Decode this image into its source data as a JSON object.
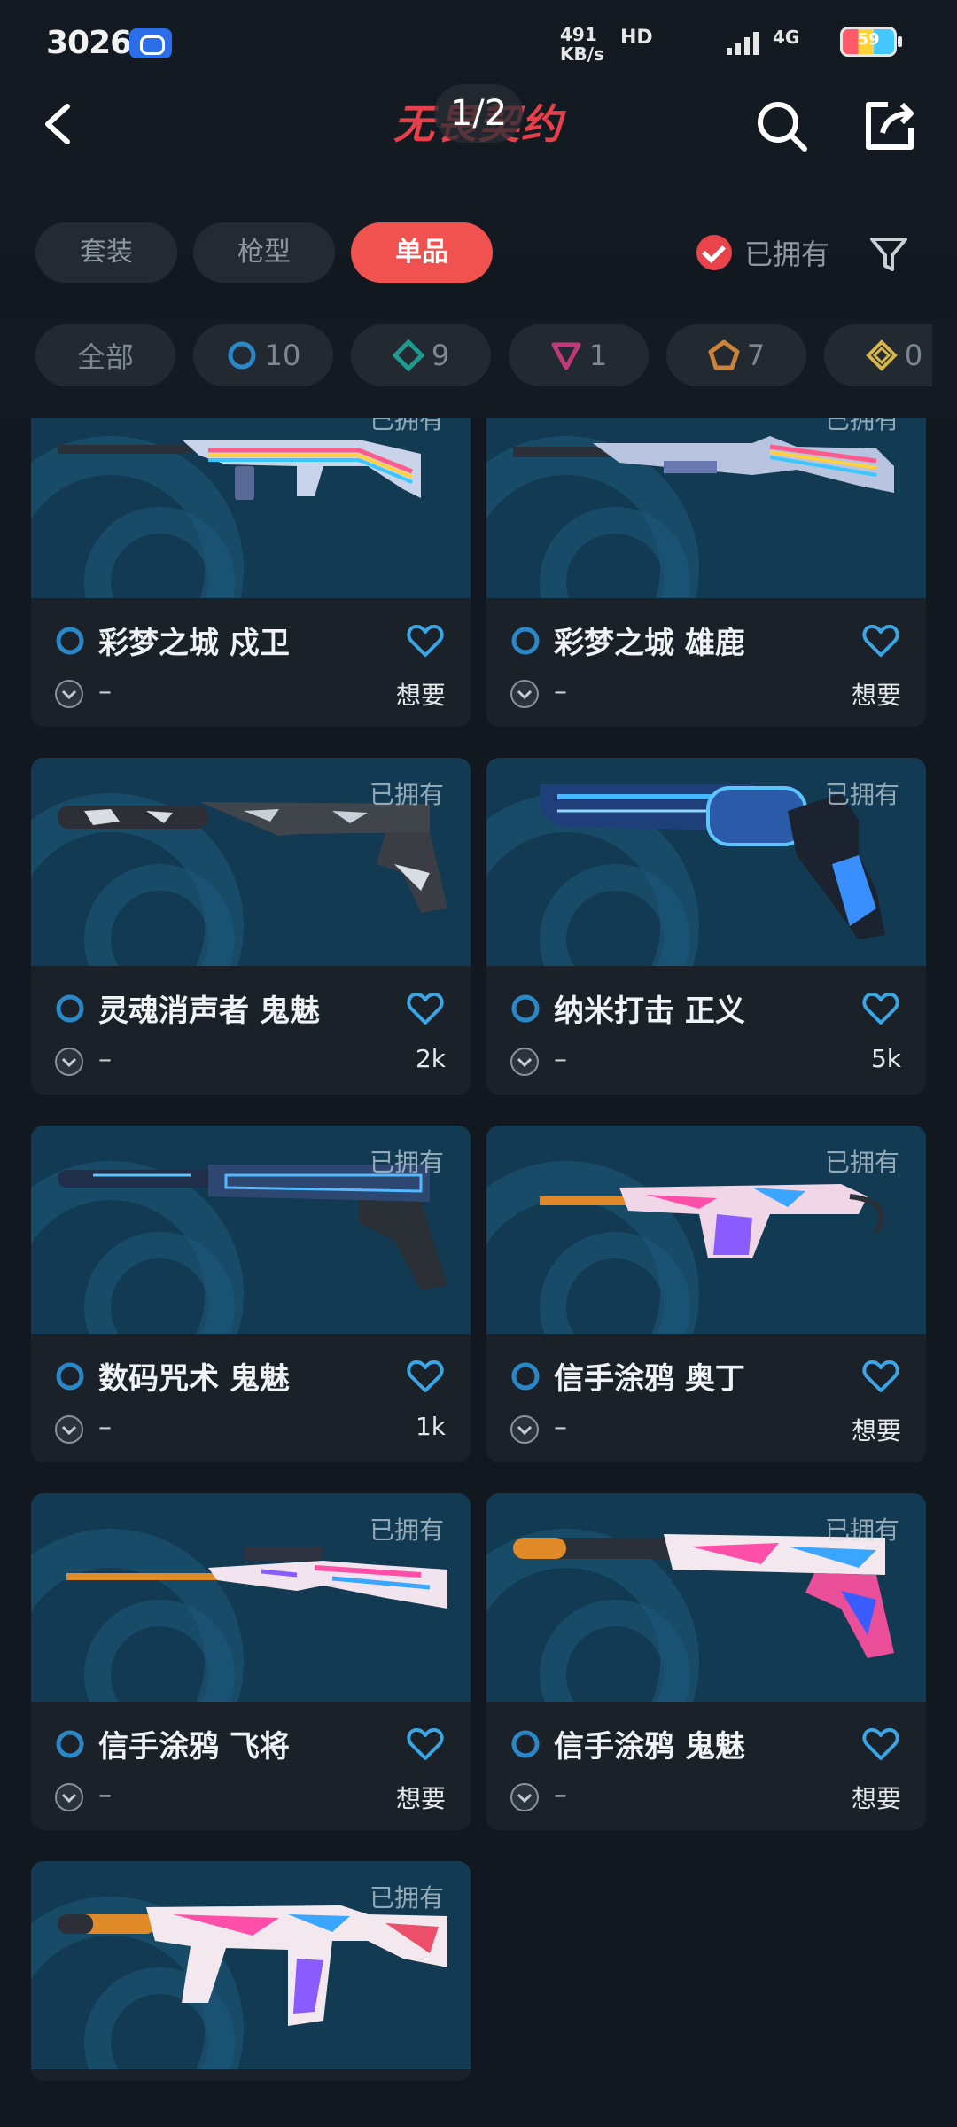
{
  "status_bar": {
    "time": "30267",
    "speed_value": "491",
    "speed_unit": "KB/s",
    "network": "HD",
    "signal": "4G",
    "battery": "59"
  },
  "header": {
    "title": "无畏契约",
    "page_indicator": "1/2"
  },
  "tabs": [
    {
      "label": "套装",
      "active": false
    },
    {
      "label": "枪型",
      "active": false
    },
    {
      "label": "单品",
      "active": true
    }
  ],
  "filter": {
    "owned_label": "已拥有",
    "owned_checked": true
  },
  "rarity_chips": [
    {
      "label": "全部",
      "icon": "all"
    },
    {
      "count": "10",
      "icon": "select-circle-icon",
      "color": "#2a88c8"
    },
    {
      "count": "9",
      "icon": "deluxe-diamond-icon",
      "color": "#1f9a8e"
    },
    {
      "count": "1",
      "icon": "premium-triangle-icon",
      "color": "#c0397a"
    },
    {
      "count": "7",
      "icon": "exclusive-pentagon-icon",
      "color": "#c9833a"
    },
    {
      "count": "0",
      "icon": "ultra-diamond-icon",
      "color": "#d6b54a"
    }
  ],
  "skins": [
    {
      "name": "彩梦之城 戍卫",
      "owned": "已拥有",
      "price": "–",
      "wishlist": "想要",
      "weapon": "rifle-rainbow"
    },
    {
      "name": "彩梦之城 雄鹿",
      "owned": "已拥有",
      "price": "–",
      "wishlist": "想要",
      "weapon": "shotgun-rainbow"
    },
    {
      "name": "灵魂消声者 鬼魅",
      "owned": "已拥有",
      "price": "–",
      "wishlist": "2k",
      "weapon": "pistol-dark"
    },
    {
      "name": "纳米打击 正义",
      "owned": "已拥有",
      "price": "–",
      "wishlist": "5k",
      "weapon": "revolver-blue"
    },
    {
      "name": "数码咒术 鬼魅",
      "owned": "已拥有",
      "price": "–",
      "wishlist": "1k",
      "weapon": "pistol-blue"
    },
    {
      "name": "信手涂鸦 奥丁",
      "owned": "已拥有",
      "price": "–",
      "wishlist": "想要",
      "weapon": "lmg-graffiti"
    },
    {
      "name": "信手涂鸦 飞将",
      "owned": "已拥有",
      "price": "–",
      "wishlist": "想要",
      "weapon": "sniper-graffiti"
    },
    {
      "name": "信手涂鸦 鬼魅",
      "owned": "已拥有",
      "price": "–",
      "wishlist": "想要",
      "weapon": "pistol-graffiti"
    },
    {
      "name": "",
      "owned": "已拥有",
      "price": "",
      "wishlist": "",
      "weapon": "smg-graffiti"
    }
  ],
  "colors": {
    "accent": "#f0534f",
    "heart": "#3aa6e6",
    "rarity_select": "#2a88c8",
    "background": "#12181f"
  }
}
